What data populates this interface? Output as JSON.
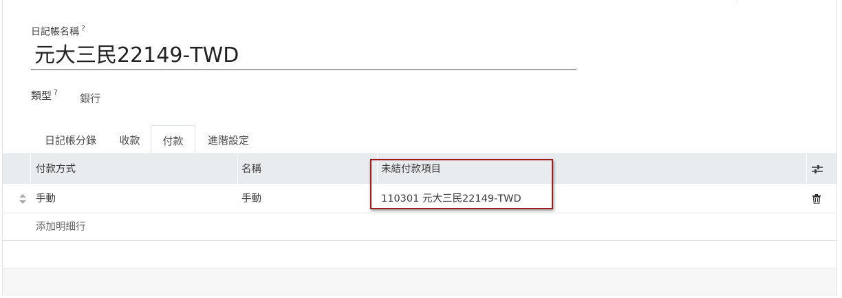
{
  "form": {
    "name_label": "日記帳名稱",
    "name_help": "?",
    "name_value": "元大三民22149-TWD",
    "type_label": "類型",
    "type_help": "?",
    "type_value": "銀行"
  },
  "tabs": [
    {
      "label": "日記帳分錄",
      "active": false
    },
    {
      "label": "收款",
      "active": false
    },
    {
      "label": "付款",
      "active": true
    },
    {
      "label": "進階設定",
      "active": false
    }
  ],
  "table": {
    "columns": [
      "付款方式",
      "名稱",
      "未結付款項目"
    ],
    "rows": [
      {
        "payment_method": "手動",
        "name": "手動",
        "outstanding_account": "110301 元大三民22149-TWD"
      }
    ],
    "add_line_label": "添加明細行"
  },
  "icons": {
    "settings": "sliders-icon",
    "handle": "sort-handle-icon",
    "delete": "trash-icon"
  },
  "colors": {
    "header_bg": "#e9ecef",
    "highlight": "#a11d1d"
  }
}
